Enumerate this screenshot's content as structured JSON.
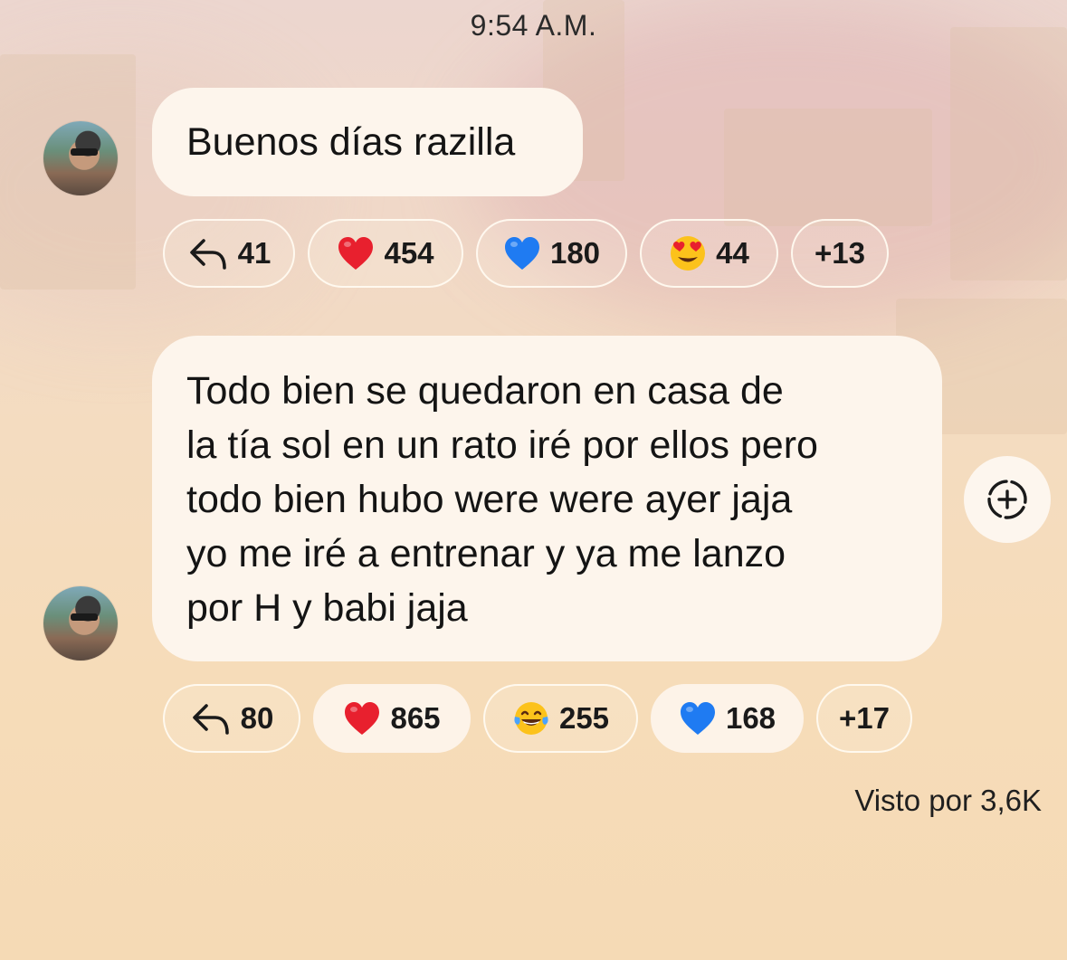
{
  "time": "9:54 A.M.",
  "messages": [
    {
      "text_lines": [
        "Buenos días razilla"
      ],
      "reactions": [
        {
          "type": "reply",
          "icon": "reply-arrow-icon",
          "count": "41"
        },
        {
          "type": "emoji",
          "icon": "red-heart-icon",
          "count": "454"
        },
        {
          "type": "emoji",
          "icon": "blue-heart-icon",
          "count": "180"
        },
        {
          "type": "emoji",
          "icon": "heart-eyes-icon",
          "count": "44"
        },
        {
          "type": "more",
          "count": "+13"
        }
      ]
    },
    {
      "text_lines": [
        "Todo bien se quedaron en casa de",
        "la tía sol en un rato iré por ellos pero",
        "todo bien hubo were were ayer jaja",
        "yo me iré a entrenar y ya me lanzo",
        "por H y babi jaja"
      ],
      "reactions": [
        {
          "type": "reply",
          "icon": "reply-arrow-icon",
          "count": "80"
        },
        {
          "type": "emoji",
          "icon": "red-heart-icon",
          "count": "865",
          "selected": true
        },
        {
          "type": "emoji",
          "icon": "tears-of-joy-icon",
          "count": "255"
        },
        {
          "type": "emoji",
          "icon": "blue-heart-icon",
          "count": "168",
          "selected": true
        },
        {
          "type": "more",
          "count": "+17"
        }
      ]
    }
  ],
  "seen_by": "Visto por 3,6K",
  "colors": {
    "bubble": "#fdf5ec",
    "heart_red": "#e8202e",
    "heart_blue": "#1f7bf2",
    "emoji_face": "#fcc21b"
  }
}
